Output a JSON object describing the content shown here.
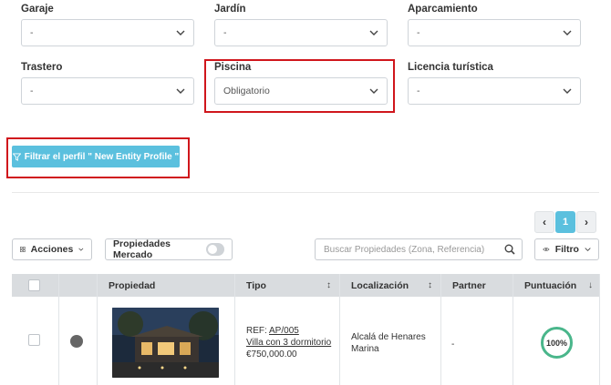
{
  "filters": {
    "garaje": {
      "label": "Garaje",
      "value": "-"
    },
    "jardin": {
      "label": "Jardín",
      "value": "-"
    },
    "aparcamiento": {
      "label": "Aparcamiento",
      "value": "-"
    },
    "trastero": {
      "label": "Trastero",
      "value": "-"
    },
    "piscina": {
      "label": "Piscina",
      "value": "Obligatorio"
    },
    "licencia": {
      "label": "Licencia turística",
      "value": "-"
    }
  },
  "filter_button": {
    "label": "Filtrar el perfil \" New Entity Profile \""
  },
  "pagination": {
    "prev": "‹",
    "current": "1",
    "next": "›"
  },
  "toolbar": {
    "acciones": "Acciones",
    "mercado": "Propiedades Mercado",
    "search_placeholder": "Buscar Propiedades (Zona, Referencia)",
    "filtro": "Filtro"
  },
  "table": {
    "headers": [
      "Propiedad",
      "Tipo",
      "Localización",
      "Partner",
      "Puntuación"
    ],
    "row": {
      "ref_prefix": "REF:",
      "ref": "AP/005",
      "title": "Villa con 3 dormitorio",
      "price": "€750,000.00",
      "location_line1": "Alcalá de Henares",
      "location_line2": "Marina",
      "partner": "-",
      "score": "100%"
    }
  },
  "colors": {
    "accent": "#5bc0de",
    "highlight": "#d0161c",
    "score_ring": "#4ab68b"
  }
}
